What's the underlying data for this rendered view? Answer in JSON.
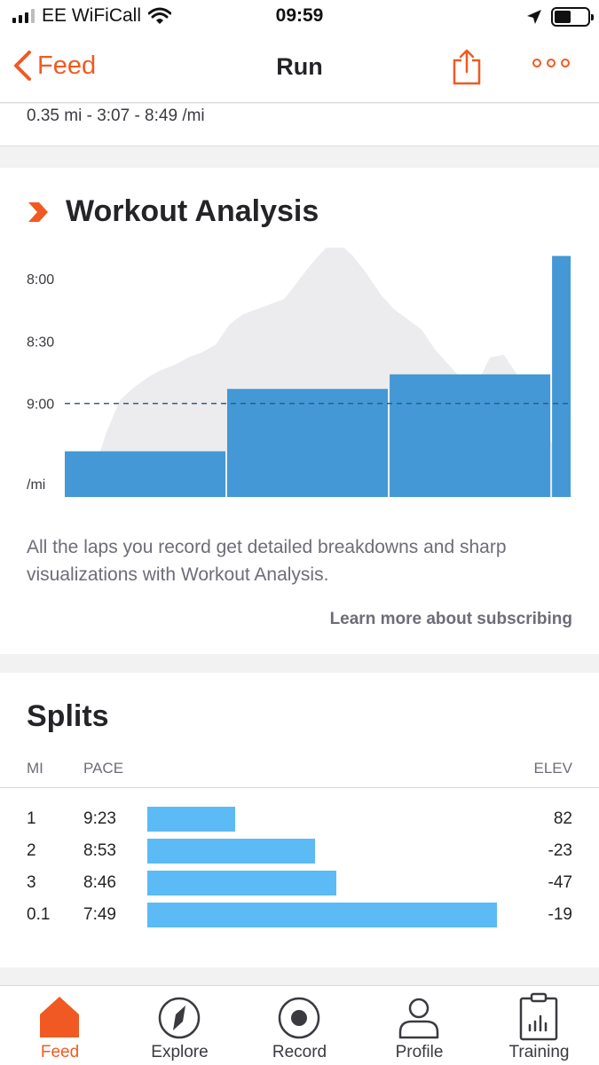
{
  "status_bar": {
    "carrier": "EE WiFiCall",
    "time": "09:59"
  },
  "nav": {
    "back_label": "Feed",
    "title": "Run",
    "icons": [
      "chevron-left-icon",
      "share-icon",
      "more-icon"
    ]
  },
  "lap_summary": "0.35 mi - 3:07 - 8:49 /mi",
  "workout_analysis": {
    "title": "Workout Analysis",
    "description": "All the laps you record get detailed breakdowns and sharp visualizations with Workout Analysis.",
    "learn_more": "Learn more about subscribing"
  },
  "chart_data": {
    "type": "bar",
    "ylabel": "/mi",
    "y_ticks": [
      "8:00",
      "8:30",
      "9:00"
    ],
    "y_inverted": true,
    "ylim_seconds_per_mi": [
      465,
      585
    ],
    "average_pace_line": "9:00",
    "bars": [
      {
        "lap": 1,
        "share_of_distance": 0.32,
        "pace": "9:23",
        "pace_seconds": 563
      },
      {
        "lap": 2,
        "share_of_distance": 0.32,
        "pace": "8:53",
        "pace_seconds": 533
      },
      {
        "lap": 3,
        "share_of_distance": 0.32,
        "pace": "8:46",
        "pace_seconds": 526
      },
      {
        "lap": 4,
        "share_of_distance": 0.04,
        "pace": "7:49",
        "pace_seconds": 469
      }
    ],
    "elevation_profile_relative": [
      0.0,
      0.02,
      0.08,
      0.25,
      0.38,
      0.43,
      0.47,
      0.5,
      0.52,
      0.55,
      0.57,
      0.6,
      0.68,
      0.72,
      0.74,
      0.76,
      0.78,
      0.85,
      0.92,
      0.98,
      1.0,
      0.95,
      0.88,
      0.8,
      0.74,
      0.7,
      0.66,
      0.58,
      0.52,
      0.46,
      0.44,
      0.55,
      0.56,
      0.48,
      0.42,
      0.3,
      0.12,
      0.0
    ]
  },
  "splits": {
    "title": "Splits",
    "headers": {
      "mi": "MI",
      "pace": "PACE",
      "elev": "ELEV"
    },
    "rows": [
      {
        "mi": "1",
        "pace": "9:23",
        "relative_speed": 0.25,
        "elev": "82"
      },
      {
        "mi": "2",
        "pace": "8:53",
        "relative_speed": 0.48,
        "elev": "-23"
      },
      {
        "mi": "3",
        "pace": "8:46",
        "relative_speed": 0.54,
        "elev": "-47"
      },
      {
        "mi": "0.1",
        "pace": "7:49",
        "relative_speed": 1.0,
        "elev": "-19"
      }
    ]
  },
  "tabs": [
    {
      "label": "Feed",
      "icon": "home-icon",
      "active": true
    },
    {
      "label": "Explore",
      "icon": "compass-icon",
      "active": false
    },
    {
      "label": "Record",
      "icon": "record-icon",
      "active": false
    },
    {
      "label": "Profile",
      "icon": "profile-icon",
      "active": false
    },
    {
      "label": "Training",
      "icon": "training-clipboard-icon",
      "active": false
    }
  ],
  "colors": {
    "accent": "#f05a22",
    "chart_bar": "#4398d5",
    "split_bar": "#5cbaf5",
    "elevation_fill": "#ececee"
  }
}
